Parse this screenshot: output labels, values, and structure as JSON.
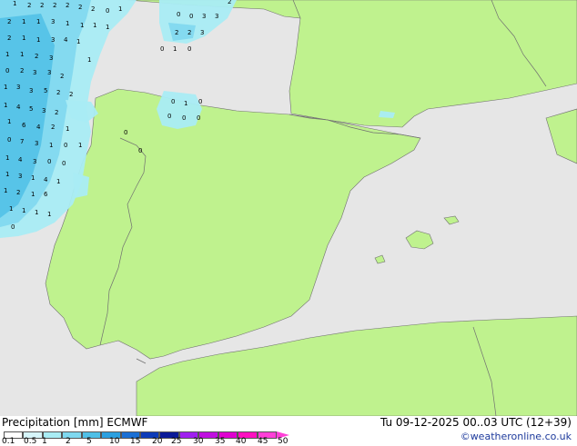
{
  "map": {
    "colors": {
      "sea": "#e6e6e6",
      "land": "#bff28e",
      "border": "#707070",
      "precip_light": "#a9ecf4",
      "precip_mid": "#7fd8ef",
      "precip_heavy": "#4fbfe6"
    },
    "precip_values": [
      {
        "v": "1"
      },
      {
        "v": "2"
      },
      {
        "v": "2"
      },
      {
        "v": "2"
      },
      {
        "v": "2"
      },
      {
        "v": "2"
      },
      {
        "v": "2"
      },
      {
        "v": "0"
      },
      {
        "v": "1"
      },
      {
        "v": "2"
      },
      {
        "v": "1"
      },
      {
        "v": "1"
      },
      {
        "v": "3"
      },
      {
        "v": "1"
      },
      {
        "v": "1"
      },
      {
        "v": "1"
      },
      {
        "v": "1"
      },
      {
        "v": "2"
      },
      {
        "v": "1"
      },
      {
        "v": "1"
      },
      {
        "v": "3"
      },
      {
        "v": "4"
      },
      {
        "v": "1"
      },
      {
        "v": "1"
      },
      {
        "v": "1"
      },
      {
        "v": "2"
      },
      {
        "v": "3"
      },
      {
        "v": "1"
      },
      {
        "v": "0"
      },
      {
        "v": "2"
      },
      {
        "v": "3"
      },
      {
        "v": "3"
      },
      {
        "v": "2"
      },
      {
        "v": "1"
      },
      {
        "v": "3"
      },
      {
        "v": "3"
      },
      {
        "v": "5"
      },
      {
        "v": "2"
      },
      {
        "v": "2"
      },
      {
        "v": "1"
      },
      {
        "v": "4"
      },
      {
        "v": "5"
      },
      {
        "v": "3"
      },
      {
        "v": "2"
      },
      {
        "v": "1"
      },
      {
        "v": "6"
      },
      {
        "v": "4"
      },
      {
        "v": "2"
      },
      {
        "v": "1"
      },
      {
        "v": "0"
      },
      {
        "v": "7"
      },
      {
        "v": "3"
      },
      {
        "v": "1"
      },
      {
        "v": "0"
      },
      {
        "v": "1"
      },
      {
        "v": "1"
      },
      {
        "v": "4"
      },
      {
        "v": "3"
      },
      {
        "v": "0"
      },
      {
        "v": "0"
      },
      {
        "v": "1"
      },
      {
        "v": "3"
      },
      {
        "v": "1"
      },
      {
        "v": "4"
      },
      {
        "v": "1"
      },
      {
        "v": "1"
      },
      {
        "v": "2"
      },
      {
        "v": "1"
      },
      {
        "v": "6"
      },
      {
        "v": "1"
      },
      {
        "v": "1"
      },
      {
        "v": "1"
      },
      {
        "v": "1"
      },
      {
        "v": "0"
      },
      {
        "v": "0"
      },
      {
        "v": "3"
      },
      {
        "v": "3"
      },
      {
        "v": "2"
      },
      {
        "v": "2"
      },
      {
        "v": "2"
      },
      {
        "v": "3"
      },
      {
        "v": "0"
      },
      {
        "v": "1"
      },
      {
        "v": "0"
      },
      {
        "v": "0"
      },
      {
        "v": "1"
      },
      {
        "v": "0"
      },
      {
        "v": "0"
      },
      {
        "v": "0"
      },
      {
        "v": "0"
      },
      {
        "v": "0"
      },
      {
        "v": "0"
      },
      {
        "v": "0"
      },
      {
        "v": "0"
      }
    ]
  },
  "footer": {
    "title": "Precipitation [mm]  ECMWF",
    "datetime": "Tu 09-12-2025 00..03 UTC (12+39)",
    "credit": "©weatheronline.co.uk"
  },
  "legend": {
    "ticks": [
      "0.1",
      "0.5",
      "1",
      "2",
      "5",
      "10",
      "15",
      "20",
      "25",
      "30",
      "35",
      "40",
      "45",
      "50"
    ],
    "colors": [
      "#ffffff",
      "#d6f5fa",
      "#a9ecf4",
      "#7fd8ef",
      "#4fbfe6",
      "#2ca0e0",
      "#1a6fd4",
      "#0d3bb8",
      "#0a1a98",
      "#a020f0",
      "#c010e0",
      "#e000d0",
      "#ff10c0",
      "#ff40d8"
    ]
  }
}
